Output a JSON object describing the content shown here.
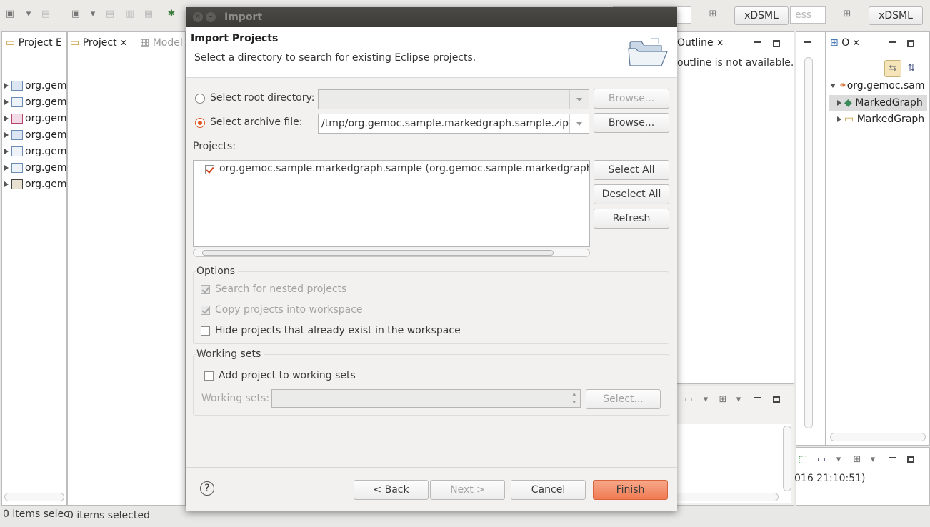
{
  "background": {
    "left_tabs": {
      "project_explorer": "Project E",
      "project": "Project",
      "model": "Model"
    },
    "tree_items": [
      "org.gem",
      "org.gem",
      "org.gem",
      "org.gem",
      "org.gem",
      "org.gem",
      "org.gem"
    ],
    "status_left": "0 items selec",
    "status_mid": "0 items selected",
    "outline_tab": "Outline",
    "outline_msg": "outline is not available.",
    "quick_access": "ess",
    "perspective_1": "xDSML",
    "perspective_2": "xDSML",
    "right_tab": "O",
    "right_tree": {
      "root": "org.gemoc.sam",
      "child1": "MarkedGraph",
      "child2": "MarkedGraph"
    },
    "console_ts": "016 21:10:51)"
  },
  "dialog": {
    "title": "Import",
    "header_title": "Import Projects",
    "header_desc": "Select a directory to search for existing Eclipse projects.",
    "root_dir_label": "Select root directory:",
    "root_dir_value": "",
    "archive_label": "Select archive file:",
    "archive_value": "/tmp/org.gemoc.sample.markedgraph.sample.zip",
    "browse_label": "Browse...",
    "projects_label": "Projects:",
    "projects": [
      {
        "name": "org.gemoc.sample.markedgraph.sample (org.gemoc.sample.markedgraph.sa",
        "checked": true
      }
    ],
    "select_all": "Select All",
    "deselect_all": "Deselect All",
    "refresh": "Refresh",
    "options_label": "Options",
    "opt_nested": "Search for nested projects",
    "opt_copy": "Copy projects into workspace",
    "opt_hide": "Hide projects that already exist in the workspace",
    "working_sets_group": "Working sets",
    "add_to_ws": "Add project to working sets",
    "working_sets_label": "Working sets:",
    "ws_select": "Select...",
    "back": "< Back",
    "next": "Next >",
    "cancel": "Cancel",
    "finish": "Finish",
    "help": "?"
  },
  "colors": {
    "accent": "#f07b52",
    "titlebar": "#3c3b37"
  }
}
